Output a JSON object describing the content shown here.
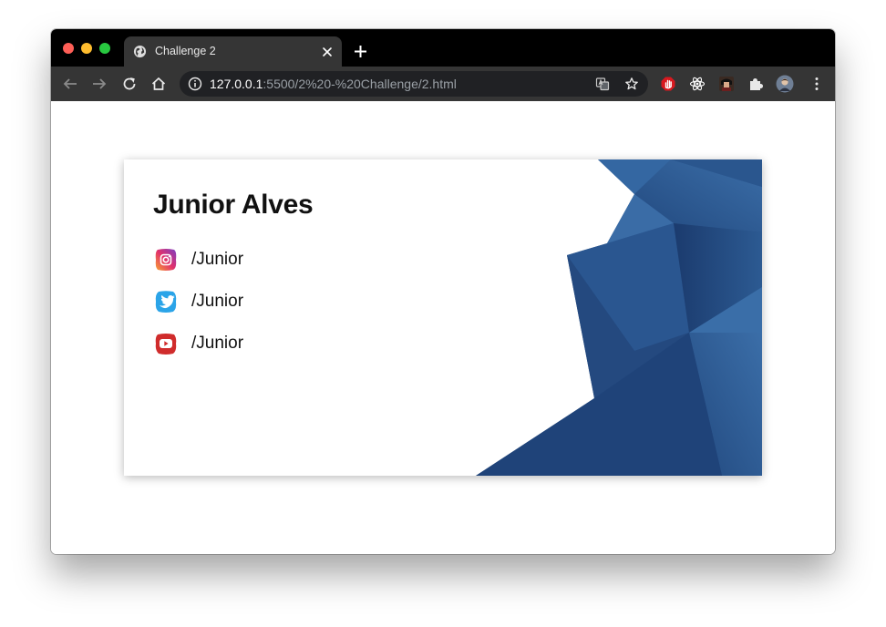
{
  "browser": {
    "tab": {
      "title": "Challenge 2"
    },
    "address": {
      "host": "127.0.0.1",
      "rest": ":5500/2%20-%20Challenge/2.html"
    }
  },
  "card": {
    "name": "Junior Alves",
    "socials": [
      {
        "network": "instagram",
        "label": "/Junior"
      },
      {
        "network": "twitter",
        "label": "/Junior"
      },
      {
        "network": "youtube",
        "label": "/Junior"
      }
    ]
  },
  "colors": {
    "art_blue_dark": "#1e3f74",
    "art_blue_light": "#35679f",
    "instagram": "#c13584",
    "twitter": "#1da1f2",
    "youtube": "#d02c2c"
  }
}
